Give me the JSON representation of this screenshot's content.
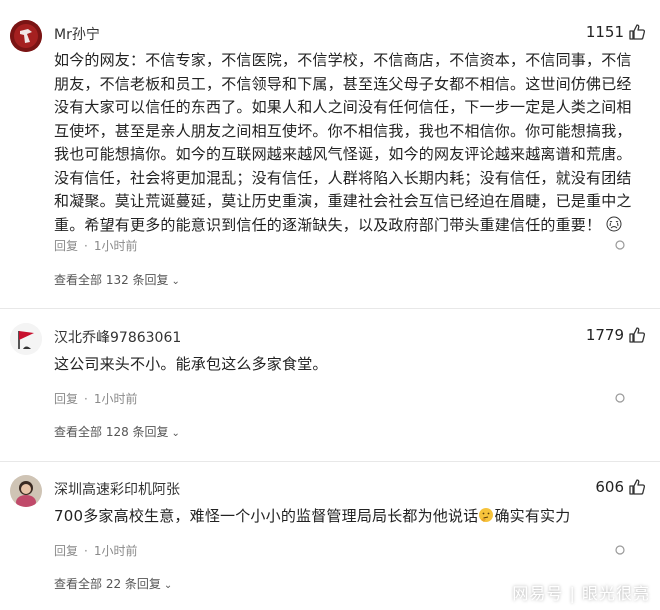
{
  "comments": [
    {
      "username": "Mr孙宁",
      "likes": "1151",
      "content": "如今的网友：不信专家，不信医院，不信学校，不信商店，不信资本，不信同事，不信朋友，不信老板和员工，不信领导和下属，甚至连父母子女都不相信。这世间仿佛已经没有大家可以信任的东西了。如果人和人之间没有任何信任，下一步一定是人类之间相互使坏，甚至是亲人朋友之间相互使坏。你不相信我，我也不相信你。你可能想搞我，我也可能想搞你。如今的互联网越来越风气怪诞，如今的网友评论越来越离谱和荒唐。没有信任，社会将更加混乱；没有信任，人群将陷入长期内耗；没有信任，就没有团结和凝聚。莫让荒诞蔓延，莫让历史重演，重建社会社会互信已经迫在眉睫，已是重中之重。希望有更多的能意识到信任的逐渐缺失，以及政府部门带头重建信任的重要！",
      "content_emoji": "crying-face-emoji",
      "reply_label": "回复",
      "time": "1小时前",
      "replies_label": "查看全部 132 条回复"
    },
    {
      "username": "汉北乔峰97863061",
      "likes": "1779",
      "content": "这公司来头不小。能承包这么多家食堂。",
      "reply_label": "回复",
      "time": "1小时前",
      "replies_label": "查看全部 128 条回复"
    },
    {
      "username": "深圳高速彩印机阿张",
      "likes": "606",
      "content_before": "700多家高校生意，难怪一个小小的监督管理局局长都为他说话",
      "content_emoji": "thinking-face-emoji",
      "content_after": "确实有实力",
      "reply_label": "回复",
      "time": "1小时前",
      "replies_label": "查看全部 22 条回复"
    }
  ],
  "watermark": "网易号 | 眼光很亮",
  "colors": {
    "text": "#222222",
    "meta": "#8a8a8a",
    "divider": "#e8e8e8"
  }
}
